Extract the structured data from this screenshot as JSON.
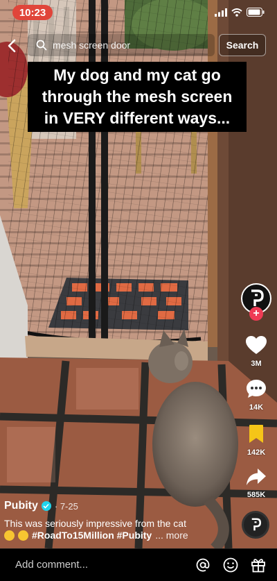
{
  "status_bar": {
    "time": "10:23"
  },
  "search": {
    "query": "mesh screen door",
    "button_label": "Search"
  },
  "caption": {
    "text": "My dog and my cat go through the mesh screen in VERY different ways..."
  },
  "rail": {
    "likes": "3M",
    "comments": "14K",
    "saves": "142K",
    "shares": "585K",
    "plus_label": "+"
  },
  "post": {
    "author": "Pubity",
    "date": "· 7-25",
    "description": "This was seriously impressive from the cat",
    "hashtags": "#RoadTo15Million #Pubity",
    "more": "... more"
  },
  "comment_bar": {
    "placeholder": "Add comment..."
  },
  "colors": {
    "time_pill": "#e0453a",
    "plus": "#ef3b55",
    "save": "#f5c518",
    "verified": "#20d5ec"
  }
}
